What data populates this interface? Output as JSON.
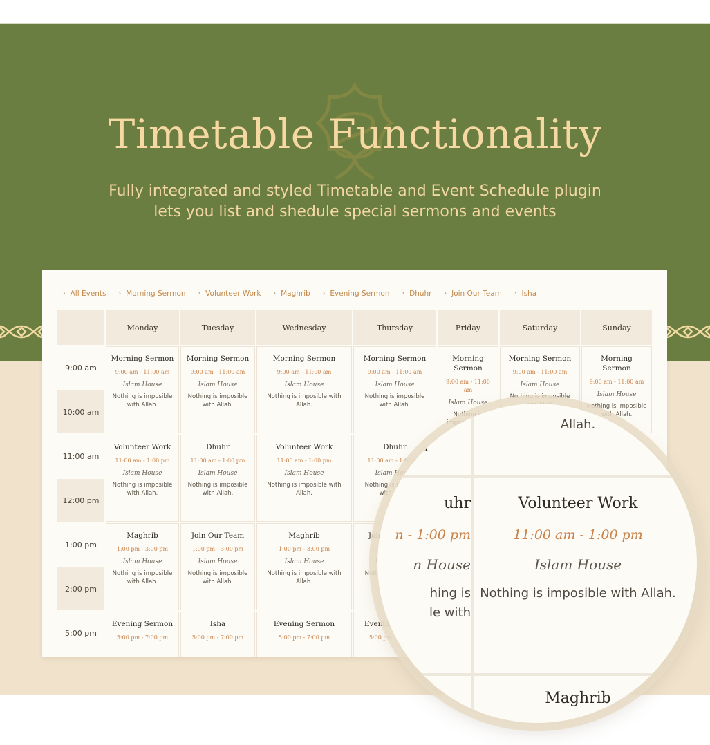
{
  "hero": {
    "title": "Timetable Functionality",
    "subtitle_line1": "Fully integrated and styled Timetable and Event Schedule plugin",
    "subtitle_line2": "lets you list and shedule special sermons and events"
  },
  "colors": {
    "green": "#6b7e41",
    "gold": "#f6d9a2",
    "beige": "#f0e2cb",
    "accent_time": "#c9824b",
    "filter_link": "#c2884a"
  },
  "filters": [
    {
      "label": "All Events",
      "icon": "chevron-right-icon"
    },
    {
      "label": "Morning Sermon",
      "icon": "chevron-right-icon"
    },
    {
      "label": "Volunteer Work",
      "icon": "chevron-right-icon"
    },
    {
      "label": "Maghrib",
      "icon": "chevron-right-icon"
    },
    {
      "label": "Evening Sermon",
      "icon": "chevron-right-icon"
    },
    {
      "label": "Dhuhr",
      "icon": "chevron-right-icon"
    },
    {
      "label": "Join Our Team",
      "icon": "chevron-right-icon"
    },
    {
      "label": "Isha",
      "icon": "chevron-right-icon"
    }
  ],
  "timetable": {
    "days": [
      "Monday",
      "Tuesday",
      "Wednesday",
      "Thursday",
      "Friday",
      "Saturday",
      "Sunday"
    ],
    "times": [
      "9:00 am",
      "10:00 am",
      "11:00 am",
      "12:00 pm",
      "1:00 pm",
      "2:00 pm",
      "5:00 pm"
    ],
    "rows": [
      {
        "events": [
          {
            "name": "Morning Sermon",
            "time": "9:00 am - 11:00 am",
            "location": "Islam House",
            "desc": "Nothing is imposible with Allah."
          },
          {
            "name": "Morning Sermon",
            "time": "9:00 am - 11:00 am",
            "location": "Islam House",
            "desc": "Nothing is imposible with Allah."
          },
          {
            "name": "Morning Sermon",
            "time": "9:00 am - 11:00 am",
            "location": "Islam House",
            "desc": "Nothing is imposible with Allah."
          },
          {
            "name": "Morning Sermon",
            "time": "9:00 am - 11:00 am",
            "location": "Islam House",
            "desc": "Nothing is imposible with Allah."
          },
          {
            "name": "Morning Sermon",
            "time": "9:00 am - 11:00 am",
            "location": "Islam House",
            "desc": "Nothing is imposible with Allah."
          },
          {
            "name": "Morning Sermon",
            "time": "9:00 am - 11:00 am",
            "location": "Islam House",
            "desc": "Nothing is imposible with Allah."
          },
          {
            "name": "Morning Sermon",
            "time": "9:00 am - 11:00 am",
            "location": "Islam House",
            "desc": "Nothing is imposible with Allah."
          }
        ]
      },
      {
        "events": [
          {
            "name": "Volunteer Work",
            "time": "11:00 am - 1:00 pm",
            "location": "Islam House",
            "desc": "Nothing is imposible with Allah."
          },
          {
            "name": "Dhuhr",
            "time": "11:00 am - 1:00 pm",
            "location": "Islam House",
            "desc": "Nothing is imposible with Allah."
          },
          {
            "name": "Volunteer Work",
            "time": "11:00 am - 1:00 pm",
            "location": "Islam House",
            "desc": "Nothing is imposible with Allah."
          },
          {
            "name": "Dhuhr",
            "time": "11:00 am - 1:00 pm",
            "location": "Islam House",
            "desc": "Nothing is imposible with Allah."
          }
        ]
      },
      {
        "events": [
          {
            "name": "Maghrib",
            "time": "1:00 pm - 3:00 pm",
            "location": "Islam House",
            "desc": "Nothing is imposible with Allah."
          },
          {
            "name": "Join Our Team",
            "time": "1:00 pm - 3:00 pm",
            "location": "Islam House",
            "desc": "Nothing is imposible with Allah."
          },
          {
            "name": "Maghrib",
            "time": "1:00 pm - 3:00 pm",
            "location": "Islam House",
            "desc": "Nothing is imposible with Allah."
          },
          {
            "name": "Join Our Team",
            "time": "1:00 pm - 3:00 pm",
            "location": "Islam House",
            "desc": "Nothing is imposible with Allah."
          }
        ]
      },
      {
        "events": [
          {
            "name": "Evening Sermon",
            "time": "5:00 pm - 7:00 pm",
            "location": "",
            "desc": ""
          },
          {
            "name": "Isha",
            "time": "5:00 pm - 7:00 pm",
            "location": "",
            "desc": ""
          },
          {
            "name": "Evening Sermon",
            "time": "5:00 pm - 7:00 pm",
            "location": "",
            "desc": ""
          },
          {
            "name": "Evening Sermon",
            "time": "5:00 pm - 7:00 pm",
            "location": "",
            "desc": ""
          }
        ]
      }
    ]
  },
  "magnifier": {
    "top_text": "Allah.",
    "top_left_fragment": "n",
    "left": {
      "name": "uhr",
      "time": "n - 1:00 pm",
      "location": "n House",
      "desc1": "hing is",
      "desc2": "le with"
    },
    "event": {
      "name": "Volunteer Work",
      "time": "11:00 am - 1:00 pm",
      "location": "Islam House",
      "desc": "Nothing is imposible with Allah."
    },
    "bottom_text": "Maghrib"
  }
}
